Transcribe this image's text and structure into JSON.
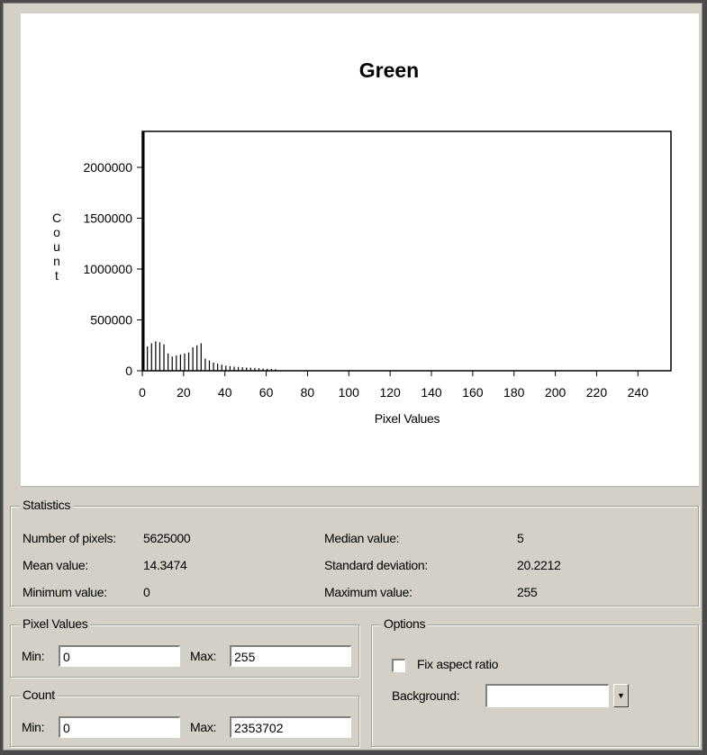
{
  "chart_data": {
    "type": "bar",
    "title": "Green",
    "xlabel": "Pixel Values",
    "ylabel": "Count",
    "xlim": [
      0,
      256
    ],
    "ylim": [
      0,
      2353702
    ],
    "xticks": [
      "0",
      "20",
      "40",
      "60",
      "80",
      "100",
      "120",
      "140",
      "160",
      "180",
      "200",
      "220",
      "240"
    ],
    "yticks": [
      "0",
      "500000",
      "1000000",
      "1500000",
      "2000000"
    ],
    "grid": false,
    "x": [
      0,
      2,
      4,
      6,
      8,
      10,
      12,
      14,
      16,
      18,
      20,
      22,
      24,
      26,
      28,
      30,
      32,
      34,
      36,
      38,
      40,
      42,
      44,
      46,
      48,
      50,
      52,
      54,
      56,
      58,
      60,
      62,
      64
    ],
    "values": [
      2353702,
      240000,
      270000,
      290000,
      280000,
      260000,
      170000,
      140000,
      150000,
      160000,
      170000,
      180000,
      230000,
      250000,
      270000,
      120000,
      100000,
      80000,
      70000,
      60000,
      50000,
      45000,
      40000,
      38000,
      35000,
      32000,
      30000,
      28000,
      25000,
      22000,
      20000,
      18000,
      15000
    ]
  },
  "statistics": {
    "legend": "Statistics",
    "num_pixels_label": "Number of pixels:",
    "num_pixels": "5625000",
    "mean_label": "Mean value:",
    "mean": "14.3474",
    "min_label": "Minimum value:",
    "min": "0",
    "median_label": "Median value:",
    "median": "5",
    "std_label": "Standard deviation:",
    "std": "20.2212",
    "max_label": "Maximum value:",
    "max": "255"
  },
  "pixel_values": {
    "legend": "Pixel Values",
    "min_label": "Min:",
    "min": "0",
    "max_label": "Max:",
    "max": "255"
  },
  "count": {
    "legend": "Count",
    "min_label": "Min:",
    "min": "0",
    "max_label": "Max:",
    "max": "2353702"
  },
  "options": {
    "legend": "Options",
    "fix_aspect_label": "Fix aspect ratio",
    "fix_aspect_checked": false,
    "background_label": "Background:",
    "background_value": ""
  }
}
